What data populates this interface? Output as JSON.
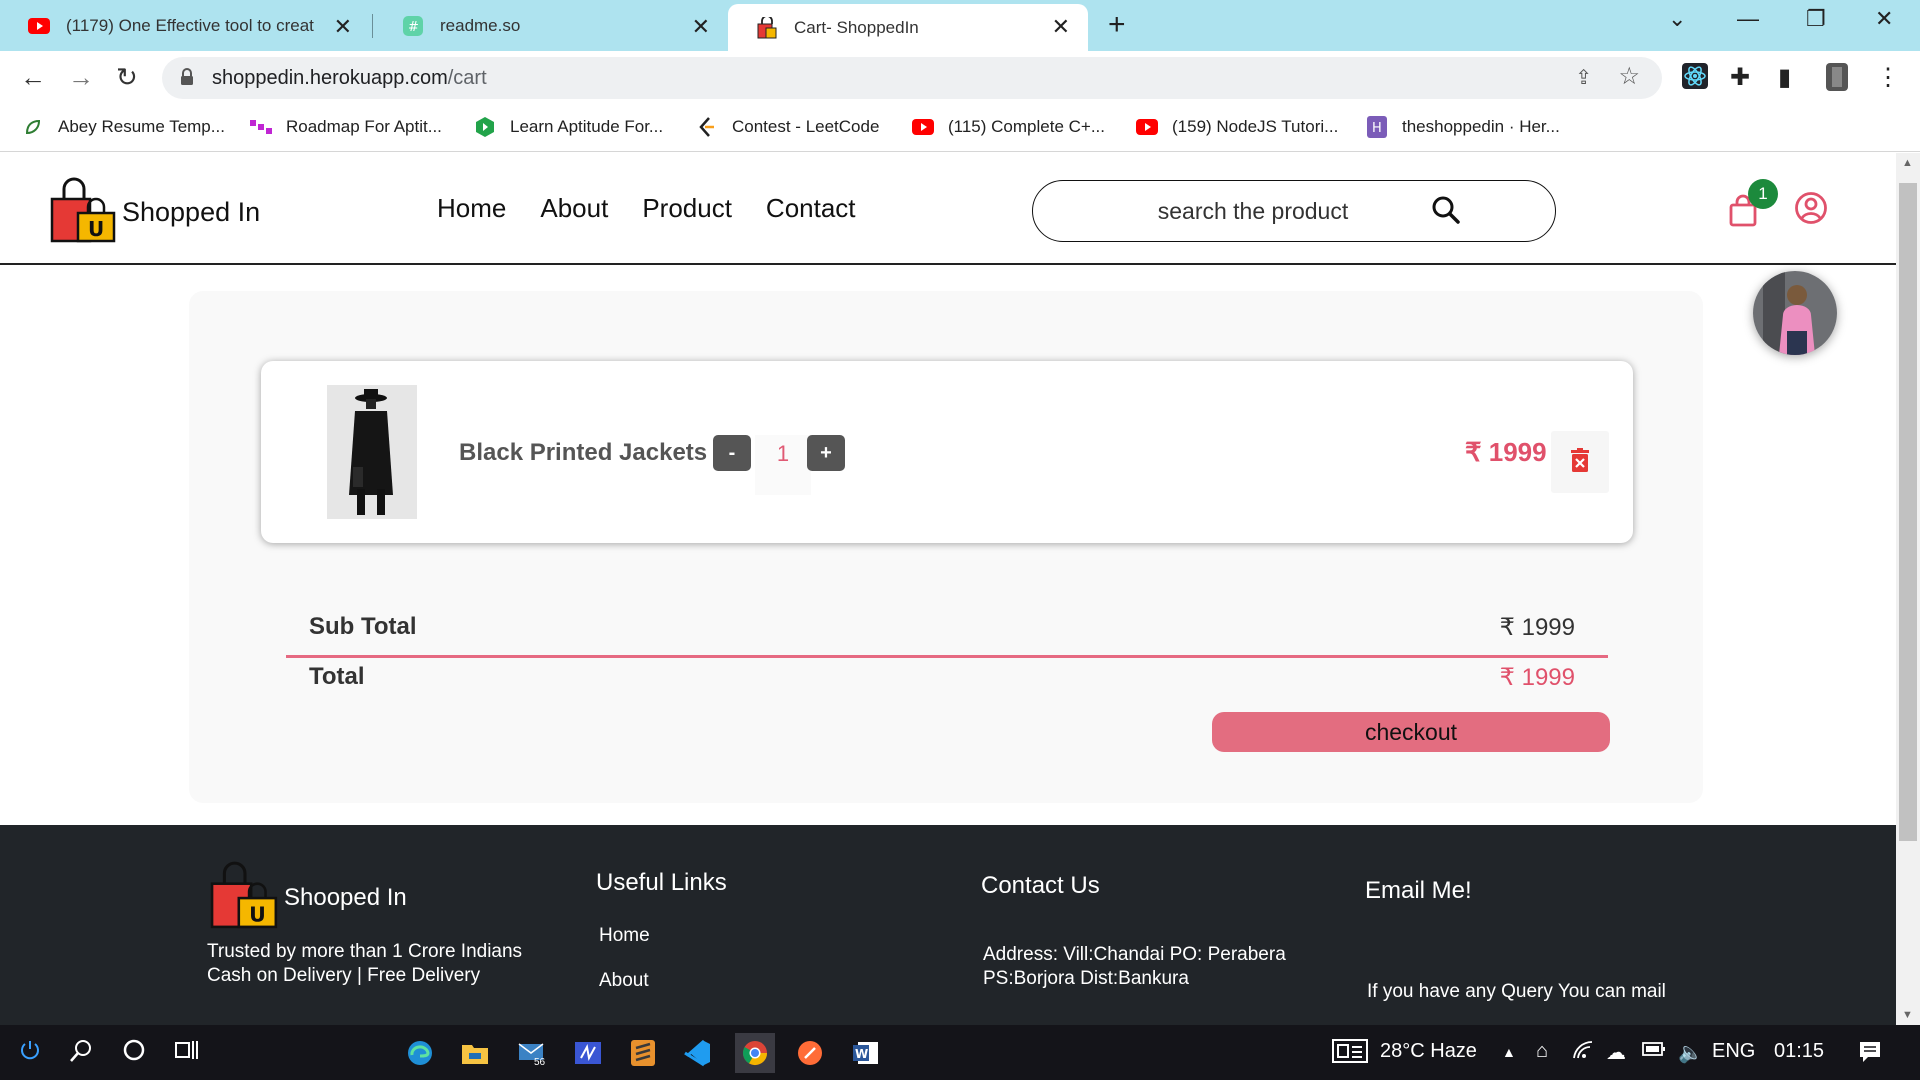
{
  "browser": {
    "tabs": [
      {
        "title": "(1179) One Effective tool to creat",
        "icon": "youtube-icon"
      },
      {
        "title": "readme.so",
        "icon": "readme-icon"
      },
      {
        "title": "Cart- ShoppedIn",
        "icon": "shopping-bag-icon"
      }
    ],
    "url_host": "shoppedin.herokuapp.com",
    "url_path": "/cart",
    "bookmarks": [
      {
        "label": "Abey Resume Temp..."
      },
      {
        "label": "Roadmap For Aptit..."
      },
      {
        "label": "Learn Aptitude For..."
      },
      {
        "label": "Contest - LeetCode"
      },
      {
        "label": "(115) Complete C+..."
      },
      {
        "label": "(159) NodeJS Tutori..."
      },
      {
        "label": "theshoppedin · Her..."
      }
    ]
  },
  "site": {
    "brand": "Shopped In",
    "nav": [
      "Home",
      "About",
      "Product",
      "Contact"
    ],
    "search_placeholder": "search the product",
    "cart_count": "1"
  },
  "cart": {
    "items": [
      {
        "name": "Black Printed Jackets",
        "quantity": "1",
        "price": "₹ 1999"
      }
    ],
    "minus_label": "-",
    "plus_label": "+",
    "subtotal_label": "Sub Total",
    "subtotal_value": "₹ 1999",
    "total_label": "Total",
    "total_value": "₹ 1999",
    "checkout_label": "checkout"
  },
  "footer": {
    "brand": "Shooped In",
    "tagline1": "Trusted by more than 1 Crore Indians",
    "tagline2": "Cash on Delivery | Free Delivery",
    "useful_links_heading": "Useful Links",
    "links": [
      "Home",
      "About"
    ],
    "contact_heading": "Contact Us",
    "address1": "Address: Vill:Chandai PO: Perabera",
    "address2": "PS:Borjora Dist:Bankura",
    "email_heading": "Email Me!",
    "email_text": "If you have any Query You can mail"
  },
  "taskbar": {
    "weather": "28°C  Haze",
    "language": "ENG",
    "time": "01:15",
    "mail_badge": "56"
  },
  "colors": {
    "accent_pink": "#e0516b",
    "checkout_bg": "#e36d80",
    "badge_green": "#1c8a3c",
    "footer_bg": "#212529",
    "tab_strip": "#aee3ef"
  }
}
